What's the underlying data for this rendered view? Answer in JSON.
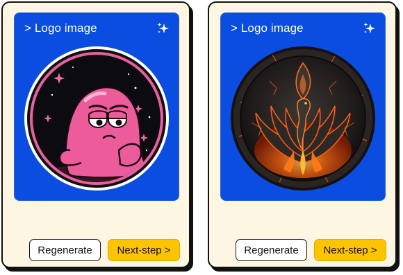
{
  "cards": [
    {
      "title": "> Logo image",
      "logo_name": "pink-blob-character-logo",
      "regenerate_label": "Regenerate",
      "next_label": "Next-step >"
    },
    {
      "title": "> Logo image",
      "logo_name": "fire-phoenix-emblem-logo",
      "regenerate_label": "Regenerate",
      "next_label": "Next-step >"
    }
  ],
  "icons": {
    "sparkle": "sparkle-icon"
  },
  "colors": {
    "card_background": "#fcf6e3",
    "panel_blue": "#0a4de0",
    "next_button": "#ffc400",
    "regenerate_button": "#ffffff",
    "outline": "#111111"
  }
}
